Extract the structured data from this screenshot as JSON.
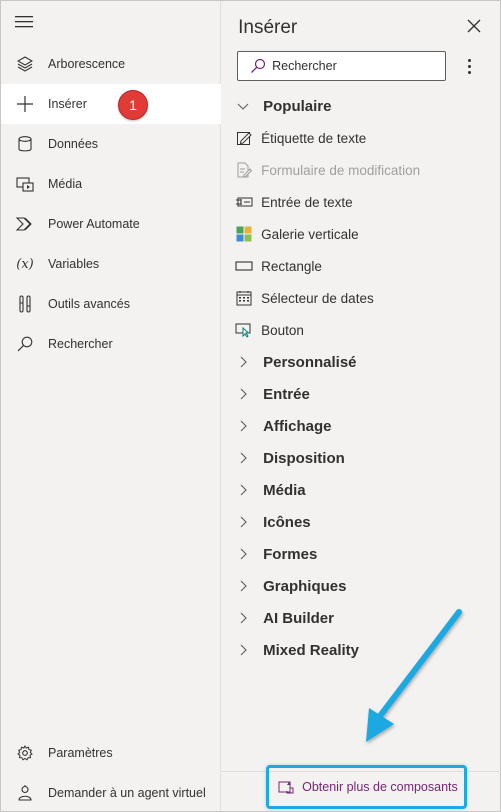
{
  "rail": {
    "items": [
      {
        "label": "Arborescence",
        "icon": "layers-icon"
      },
      {
        "label": "Insérer",
        "icon": "plus-icon",
        "active": true
      },
      {
        "label": "Données",
        "icon": "database-icon"
      },
      {
        "label": "Média",
        "icon": "media-icon"
      },
      {
        "label": "Power Automate",
        "icon": "power-automate-icon"
      },
      {
        "label": "Variables",
        "icon": "variables-icon"
      },
      {
        "label": "Outils avancés",
        "icon": "tools-icon"
      },
      {
        "label": "Rechercher",
        "icon": "search-icon"
      }
    ],
    "bottom_items": [
      {
        "label": "Paramètres",
        "icon": "gear-icon"
      },
      {
        "label": "Demander à un agent virtuel",
        "icon": "agent-icon"
      }
    ],
    "badge": "1"
  },
  "pane": {
    "title": "Insérer",
    "search_placeholder": "Rechercher",
    "popular_label": "Populaire",
    "controls": [
      {
        "label": "Étiquette de texte",
        "icon": "label-icon"
      },
      {
        "label": "Formulaire de modification",
        "icon": "edit-form-icon",
        "disabled": true
      },
      {
        "label": "Entrée de texte",
        "icon": "text-input-icon"
      },
      {
        "label": "Galerie verticale",
        "icon": "gallery-icon"
      },
      {
        "label": "Rectangle",
        "icon": "rectangle-icon"
      },
      {
        "label": "Sélecteur de dates",
        "icon": "calendar-icon"
      },
      {
        "label": "Bouton",
        "icon": "button-icon"
      }
    ],
    "categories": [
      "Personnalisé",
      "Entrée",
      "Affichage",
      "Disposition",
      "Média",
      "Icônes",
      "Formes",
      "Graphiques",
      "AI Builder",
      "Mixed Reality"
    ],
    "get_more_label": "Obtenir plus de composants"
  },
  "colors": {
    "background": "#f3f2f1",
    "active_item": "#ffffff",
    "badge": "#e03b37",
    "highlight": "#1fa9e1",
    "link": "#742774"
  }
}
